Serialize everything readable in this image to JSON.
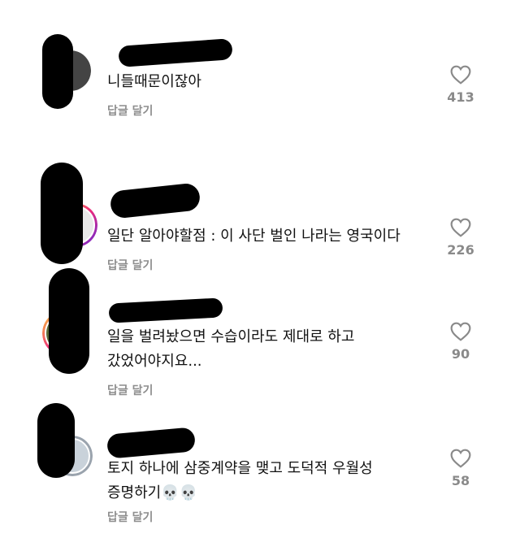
{
  "comments": [
    {
      "text": [
        "니들때문이잖아"
      ],
      "reply_label": "답글 달기",
      "likes": "413"
    },
    {
      "text": [
        "일단 알아야할점 : 이 사단 벌인 나라는 영국이다"
      ],
      "reply_label": "답글 달기",
      "likes": "226"
    },
    {
      "text": [
        "일을 벌려놨으면 수습이라도 제대로 하고",
        "갔었어야지요..."
      ],
      "reply_label": "답글 달기",
      "likes": "90"
    },
    {
      "text": [
        "토지 하나에 삼중계약을 맺고 도덕적 우월성",
        "증명하기💀💀"
      ],
      "reply_label": "답글 달기",
      "likes": "58"
    }
  ],
  "icons": {
    "like": "heart-outline-icon"
  },
  "colors": {
    "secondary_text": "#8e8e8e",
    "avatar_ring": "#d4145a"
  }
}
